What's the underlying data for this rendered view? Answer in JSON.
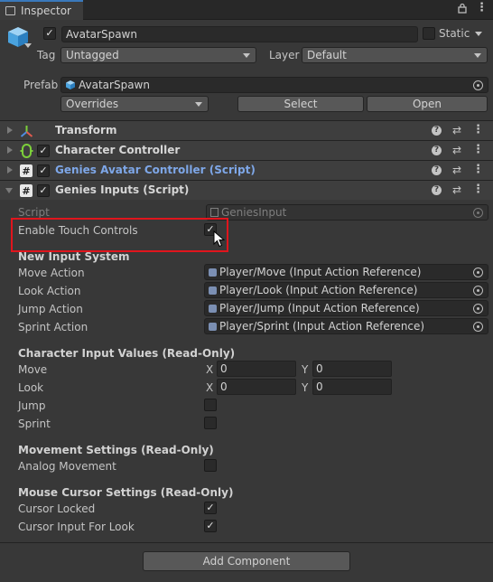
{
  "tab": {
    "title": "Inspector"
  },
  "header": {
    "name": "AvatarSpawn",
    "static_label": "Static",
    "tag_label": "Tag",
    "tag_value": "Untagged",
    "layer_label": "Layer",
    "layer_value": "Default",
    "prefab_label": "Prefab",
    "prefab_value": "AvatarSpawn",
    "overrides": "Overrides",
    "select": "Select",
    "open": "Open"
  },
  "components": [
    {
      "title": "Transform"
    },
    {
      "title": "Character Controller"
    },
    {
      "title": "Genies Avatar Controller (Script)"
    },
    {
      "title": "Genies Inputs (Script)"
    }
  ],
  "inputs": {
    "script_label": "Script",
    "script_value": "GeniesInput",
    "touch_label": "Enable Touch Controls",
    "new_input_section": "New Input System",
    "actions": [
      {
        "label": "Move Action",
        "value": "Player/Move (Input Action Reference)"
      },
      {
        "label": "Look Action",
        "value": "Player/Look (Input Action Reference)"
      },
      {
        "label": "Jump Action",
        "value": "Player/Jump (Input Action Reference)"
      },
      {
        "label": "Sprint Action",
        "value": "Player/Sprint (Input Action Reference)"
      }
    ],
    "values_section": "Character Input Values (Read-Only)",
    "move_label": "Move",
    "look_label": "Look",
    "jump_label": "Jump",
    "sprint_label": "Sprint",
    "x": "X",
    "y": "Y",
    "move_x": "0",
    "move_y": "0",
    "look_x": "0",
    "look_y": "0",
    "movement_section": "Movement Settings (Read-Only)",
    "analog_label": "Analog Movement",
    "cursor_section": "Mouse Cursor Settings (Read-Only)",
    "cursor_locked_label": "Cursor Locked",
    "cursor_look_label": "Cursor Input For Look"
  },
  "add_component": "Add Component",
  "checkmark": "✓",
  "icons": {
    "tab": "window-icon",
    "lock": "lock-icon",
    "menu": "kebab-menu-icon",
    "gameobject": "cube-icon",
    "help": "question-icon",
    "presets": "sliders-icon"
  },
  "colors": {
    "background": "#383838",
    "highlight": "#e0151d",
    "link": "#7ea7e8",
    "tab_accent": "#3a79bb"
  }
}
